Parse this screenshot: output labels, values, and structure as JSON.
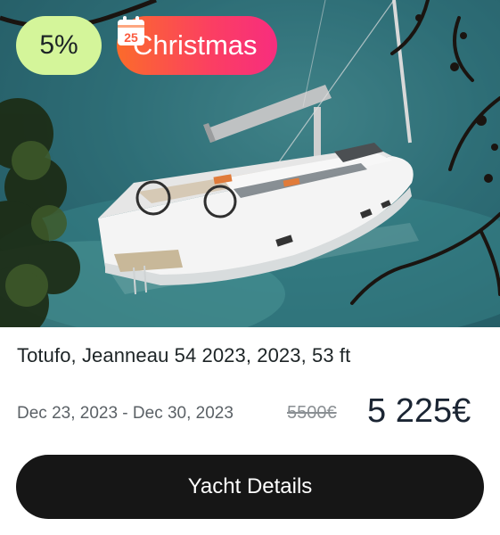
{
  "badges": {
    "discount": "5%",
    "event_label": "Christmas",
    "event_icon": "calendar-icon",
    "event_day": "25"
  },
  "listing": {
    "title": "Totufo, Jeanneau 54 2023, 2023, 53 ft",
    "dates": "Dec 23, 2023 - Dec 30, 2023",
    "old_price": "5500€",
    "price": "5 225€"
  },
  "actions": {
    "details_label": "Yacht Details"
  },
  "colors": {
    "discount_badge": "#d4f59a",
    "event_badge_start": "#fb6b2b",
    "event_badge_end": "#f72d7e",
    "button_bg": "#161616"
  }
}
